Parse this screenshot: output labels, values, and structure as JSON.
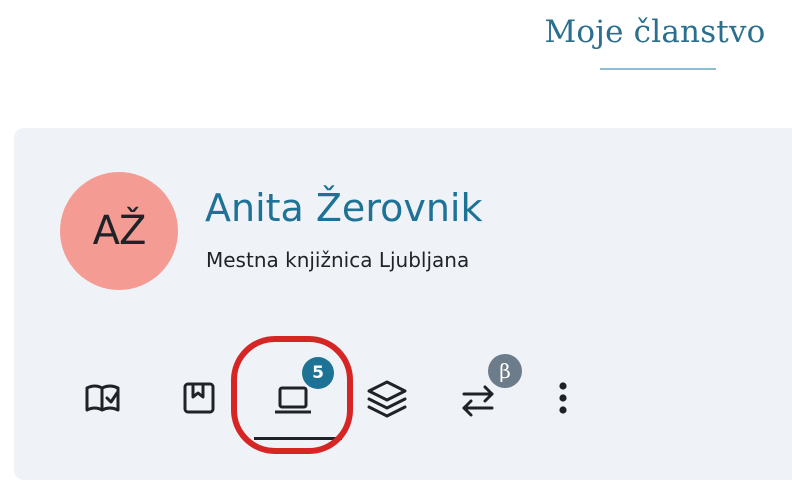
{
  "header": {
    "title": "Moje članstvo"
  },
  "profile": {
    "avatar_initials": "AŽ",
    "name": "Anita Žerovnik",
    "library": "Mestna knjižnica Ljubljana"
  },
  "tabs": {
    "items": [
      {
        "icon": "open-book-check-icon",
        "active": false
      },
      {
        "icon": "bookmark-book-icon",
        "active": false
      },
      {
        "icon": "laptop-icon",
        "active": true,
        "badge": "5"
      },
      {
        "icon": "layers-icon",
        "active": false
      },
      {
        "icon": "arrows-exchange-icon",
        "active": false,
        "badge": "β"
      },
      {
        "icon": "more-vertical-icon",
        "active": false
      }
    ]
  },
  "colors": {
    "accent": "#1e7295",
    "avatar_bg": "#f49b93",
    "card_bg": "#eff3f7",
    "highlight": "#d62525",
    "beta_badge": "#6d7c8a"
  }
}
